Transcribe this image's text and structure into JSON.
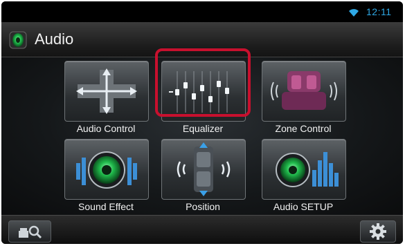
{
  "status": {
    "time": "12:11",
    "wifi_icon": "wifi-icon"
  },
  "header": {
    "title": "Audio",
    "icon": "audio-icon"
  },
  "tiles": [
    {
      "label": "Audio Control",
      "icon": "audio-control-icon"
    },
    {
      "label": "Equalizer",
      "icon": "equalizer-icon",
      "selected": true
    },
    {
      "label": "Zone Control",
      "icon": "zone-control-icon"
    },
    {
      "label": "Sound Effect",
      "icon": "sound-effect-icon"
    },
    {
      "label": "Position",
      "icon": "position-icon"
    },
    {
      "label": "Audio SETUP",
      "icon": "audio-setup-icon"
    }
  ],
  "bottom": {
    "left_icon": "search-icon",
    "right_icon": "gear-icon"
  },
  "colors": {
    "clock": "#2fa9e6",
    "highlight": "#c8102e",
    "accent_green": "#1fb84a"
  }
}
